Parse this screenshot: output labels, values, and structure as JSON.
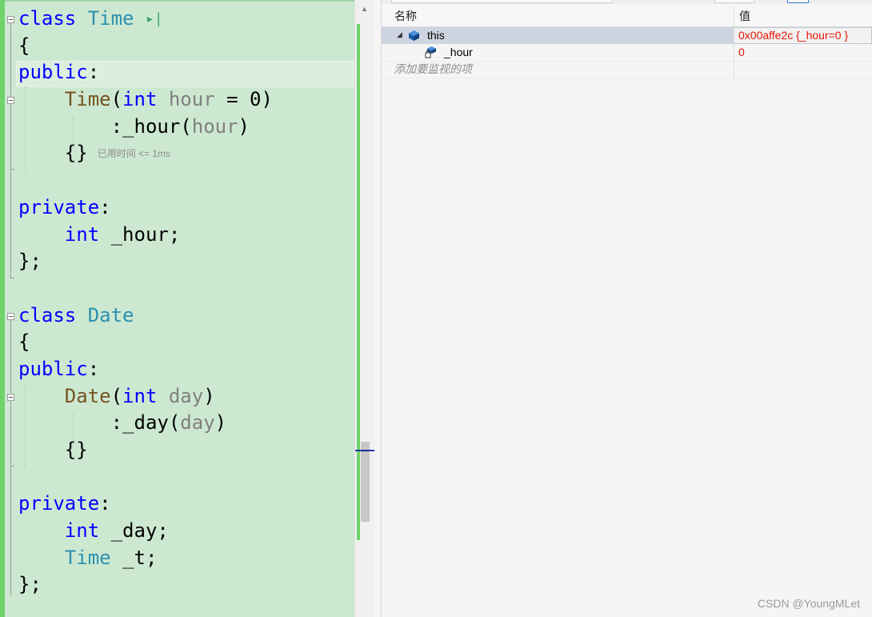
{
  "editor": {
    "lines": [
      {
        "tokens": [
          {
            "t": "class",
            "c": "kw"
          },
          {
            "t": " "
          },
          {
            "t": "Time",
            "c": "ty"
          },
          {
            "t": " "
          },
          {
            "t": "▸|",
            "c": "arrow"
          }
        ]
      },
      {
        "tokens": [
          {
            "t": "{"
          }
        ]
      },
      {
        "tokens": [
          {
            "t": "public",
            "c": "kw"
          },
          {
            "t": ":"
          }
        ]
      },
      {
        "tokens": [
          {
            "t": "    "
          },
          {
            "t": "Time",
            "c": "fn"
          },
          {
            "t": "("
          },
          {
            "t": "int",
            "c": "kw"
          },
          {
            "t": " "
          },
          {
            "t": "hour",
            "c": "pm"
          },
          {
            "t": " = 0)"
          }
        ]
      },
      {
        "tokens": [
          {
            "t": "        :_hour("
          },
          {
            "t": "hour",
            "c": "pm"
          },
          {
            "t": ")"
          }
        ]
      },
      {
        "tokens": [
          {
            "t": "    {}"
          },
          {
            "t": "已用时间 <= 1ms",
            "c": "hint"
          }
        ]
      },
      {
        "tokens": []
      },
      {
        "tokens": [
          {
            "t": "private",
            "c": "kw"
          },
          {
            "t": ":"
          }
        ]
      },
      {
        "tokens": [
          {
            "t": "    "
          },
          {
            "t": "int",
            "c": "kw"
          },
          {
            "t": " _hour;"
          }
        ]
      },
      {
        "tokens": [
          {
            "t": "};"
          }
        ]
      },
      {
        "tokens": []
      },
      {
        "tokens": [
          {
            "t": "class",
            "c": "kw"
          },
          {
            "t": " "
          },
          {
            "t": "Date",
            "c": "ty"
          }
        ]
      },
      {
        "tokens": [
          {
            "t": "{"
          }
        ]
      },
      {
        "tokens": [
          {
            "t": "public",
            "c": "kw"
          },
          {
            "t": ":"
          }
        ]
      },
      {
        "tokens": [
          {
            "t": "    "
          },
          {
            "t": "Date",
            "c": "fn"
          },
          {
            "t": "("
          },
          {
            "t": "int",
            "c": "kw"
          },
          {
            "t": " "
          },
          {
            "t": "day",
            "c": "pm"
          },
          {
            "t": ")"
          }
        ]
      },
      {
        "tokens": [
          {
            "t": "        :_day("
          },
          {
            "t": "day",
            "c": "pm"
          },
          {
            "t": ")"
          }
        ]
      },
      {
        "tokens": [
          {
            "t": "    {}"
          }
        ]
      },
      {
        "tokens": []
      },
      {
        "tokens": [
          {
            "t": "private",
            "c": "kw"
          },
          {
            "t": ":"
          }
        ]
      },
      {
        "tokens": [
          {
            "t": "    "
          },
          {
            "t": "int",
            "c": "kw"
          },
          {
            "t": " _day;"
          }
        ]
      },
      {
        "tokens": [
          {
            "t": "    "
          },
          {
            "t": "Time",
            "c": "ty"
          },
          {
            "t": " _t;"
          }
        ]
      },
      {
        "tokens": [
          {
            "t": "};"
          }
        ]
      }
    ],
    "colors": {
      "keyword": "#0000ff",
      "type": "#2b91af",
      "function": "#74531f",
      "parameter": "#808080",
      "background": "#cde8d1",
      "change_bar": "#6fd36a"
    }
  },
  "watch": {
    "header": {
      "name": "名称",
      "value": "值"
    },
    "rows": [
      {
        "name": "this",
        "value": "0x00affe2c {_hour=0 }",
        "icon": "object-icon",
        "expanded": true,
        "selected": true,
        "value_changed": true
      },
      {
        "name": "_hour",
        "value": "0",
        "icon": "private-field-icon",
        "value_changed": true
      }
    ],
    "placeholder": "添加要监视的项"
  },
  "watermark": "CSDN @YoungMLet"
}
